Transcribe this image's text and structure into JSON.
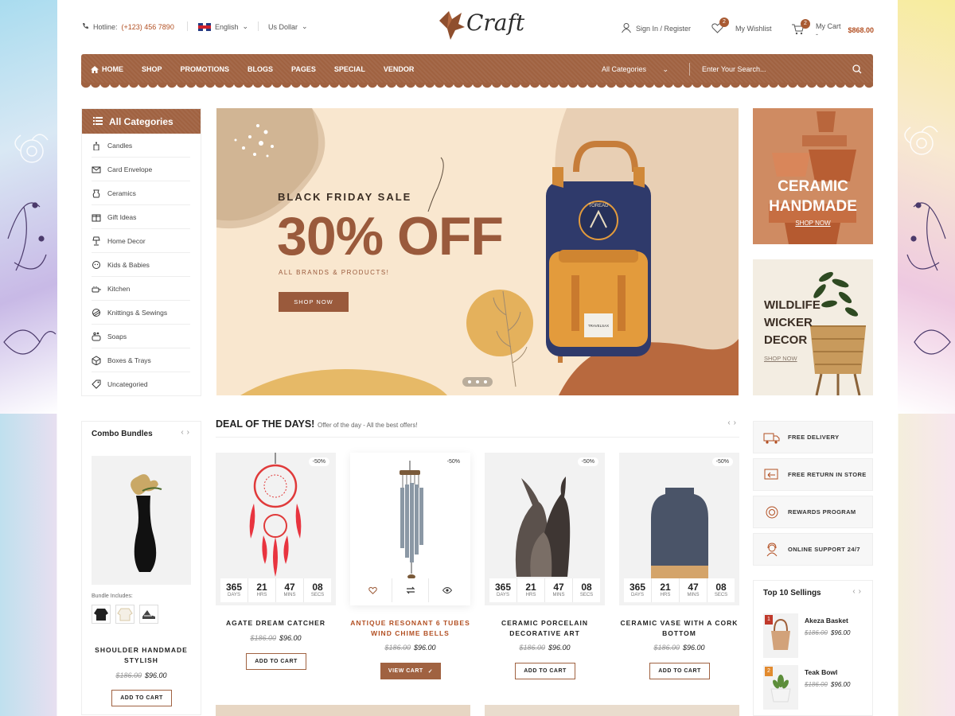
{
  "topbar": {
    "hotline_label": "Hotline:",
    "hotline_number": "(+123) 456 7890",
    "language": "English",
    "currency": "Us Dollar",
    "logo_text": "Craft",
    "signin": "Sign In / Register",
    "wishlist_label": "My Wishlist",
    "wishlist_count": "2",
    "cart_label": "My Cart -",
    "cart_total": "$868.00",
    "cart_count": "2"
  },
  "nav": {
    "items": [
      "HOME",
      "SHOP",
      "PROMOTIONS",
      "BLOGS",
      "PAGES",
      "SPECIAL",
      "VENDOR"
    ],
    "category_select": "All Categories",
    "search_placeholder": "Enter Your Search..."
  },
  "categories": {
    "title": "All Categories",
    "items": [
      "Candles",
      "Card Envelope",
      "Ceramics",
      "Gift Ideas",
      "Home Decor",
      "Kids & Babies",
      "Kitchen",
      "Knittings & Sewings",
      "Soaps",
      "Boxes & Trays",
      "Uncategoried"
    ]
  },
  "hero": {
    "kicker": "BLACK FRIDAY SALE",
    "headline": "30% OFF",
    "sub": "ALL BRANDS & PRODUCTS!",
    "button": "SHOP NOW",
    "bag_brand": "TOREAD",
    "bag_tag": "TRAVELSAX"
  },
  "banners": {
    "ceramic_title": "CERAMIC HANDMADE",
    "ceramic_cta": "SHOP NOW",
    "wildlife_title": "WILDLIFE WICKER DECOR",
    "wildlife_cta": "SHOP NOW"
  },
  "combo": {
    "title": "Combo Bundles",
    "includes_label": "Bundle Includes:",
    "product_name": "SHOULDER HANDMADE STYLISH",
    "old_price": "$186.00",
    "new_price": "$96.00",
    "button": "ADD TO CART"
  },
  "deals": {
    "title": "DEAL OF THE DAYS!",
    "subtitle": "Offer of the day - All the best offers!",
    "timer_labels": [
      "DAYS",
      "HRS",
      "MINS",
      "SECS"
    ],
    "products": [
      {
        "name": "AGATE DREAM CATCHER",
        "discount": "-50%",
        "old_price": "$186.00",
        "new_price": "$96.00",
        "button": "ADD TO CART",
        "timer": [
          "365",
          "21",
          "47",
          "08"
        ]
      },
      {
        "name": "ANTIQUE RESONANT 6 TUBES WIND CHIME BELLS",
        "discount": "-50%",
        "old_price": "$186.00",
        "new_price": "$96.00",
        "button": "VIEW CART"
      },
      {
        "name": "CERAMIC PORCELAIN DECORATIVE ART",
        "discount": "-50%",
        "old_price": "$186.00",
        "new_price": "$96.00",
        "button": "ADD TO CART",
        "timer": [
          "365",
          "21",
          "47",
          "08"
        ]
      },
      {
        "name": "CERAMIC VASE WITH A CORK BOTTOM",
        "discount": "-50%",
        "old_price": "$186.00",
        "new_price": "$96.00",
        "button": "ADD TO CART",
        "timer": [
          "365",
          "21",
          "47",
          "08"
        ]
      }
    ]
  },
  "services": [
    "FREE DELIVERY",
    "FREE RETURN IN STORE",
    "REWARDS PROGRAM",
    "ONLINE SUPPORT 24/7"
  ],
  "top_sellings": {
    "title": "Top 10 Sellings",
    "items": [
      {
        "rank": "1",
        "name": "Akeza Basket",
        "old_price": "$186.00",
        "new_price": "$96.00"
      },
      {
        "rank": "2",
        "name": "Teak Bowl",
        "old_price": "$186.00",
        "new_price": "$96.00"
      }
    ]
  },
  "colors": {
    "brand": "#a06241",
    "accent": "#b24f22",
    "hero_bg": "#f9e7cf"
  }
}
